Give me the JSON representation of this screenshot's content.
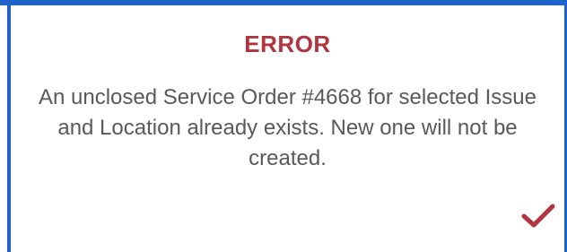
{
  "dialog": {
    "title": "ERROR",
    "message": "An unclosed Service Order #4668 for selected Issue and Location already exists. New one will not be created.",
    "confirm_icon": "checkmark-icon"
  },
  "colors": {
    "title": "#b0353f",
    "message_text": "#595959",
    "checkmark": "#b0353f",
    "frame_border": "#1e63c9"
  }
}
